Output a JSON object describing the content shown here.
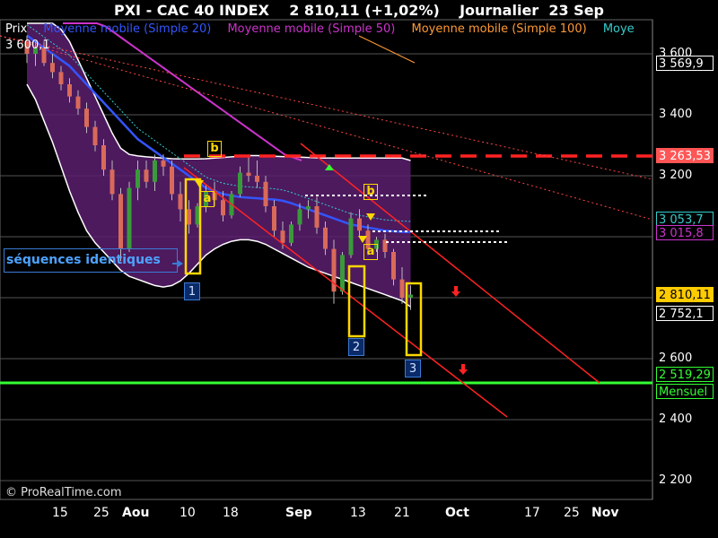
{
  "header": {
    "title": "PXI - CAC 40 INDEX    2 810,11 (+1,02%)    Journalier  23 Sep"
  },
  "legend": [
    {
      "label": "Prix",
      "color": "#ffffff"
    },
    {
      "label": "Moyenne mobile (Simple 20)",
      "color": "#3355ff"
    },
    {
      "label": "Moyenne mobile (Simple 50)",
      "color": "#cc33cc"
    },
    {
      "label": "Moyenne mobile (Simple 100)",
      "color": "#ff9933"
    },
    {
      "label": "Moye",
      "color": "#33cccc"
    }
  ],
  "top_value": "3 600,1",
  "annotations": {
    "sequence_label": "séquences identiques",
    "numbers": [
      "1",
      "2",
      "3"
    ],
    "letters": [
      "a",
      "b",
      "a",
      "b",
      "a"
    ]
  },
  "price_badges": [
    {
      "text": "3 569,9",
      "bg": "#000000",
      "fg": "#ffffff",
      "border": "#ffffff",
      "value": 3569.9
    },
    {
      "text": "3 263,53",
      "bg": "#ff5555",
      "fg": "#ffffff",
      "border": "#ff5555",
      "value": 3263.53
    },
    {
      "text": "3 053,7",
      "bg": "#000000",
      "fg": "#33cccc",
      "border": "#33cccc",
      "value": 3053.7
    },
    {
      "text": "3 015,8",
      "bg": "#000000",
      "fg": "#cc33cc",
      "border": "#cc33cc",
      "value": 3015.8
    },
    {
      "text": "2 810,11",
      "bg": "#ffcc00",
      "fg": "#000000",
      "border": "#ffcc00",
      "value": 2810.11
    },
    {
      "text": "2 752,1",
      "bg": "#000000",
      "fg": "#ffffff",
      "border": "#ffffff",
      "value": 2752.1
    },
    {
      "text": "2 519,29",
      "bg": "#000000",
      "fg": "#33ff33",
      "border": "#33ff33",
      "value": 2519.29
    },
    {
      "text": "Mensuel",
      "bg": "#000000",
      "fg": "#33ff33",
      "border": "#33ff33",
      "value": null
    }
  ],
  "copyright": "© ProRealTime.com",
  "colors": {
    "background": "#000000",
    "grid": "#555555",
    "bollinger_fill": "#5a1e6e",
    "support": "#33ff33",
    "resistance": "#ff2222",
    "annotation": "#ffd700"
  },
  "chart_data": {
    "type": "candlestick",
    "title": "PXI - CAC 40 INDEX    2 810,11 (+1,02%)    Journalier  23 Sep",
    "ylim": [
      2100,
      3700
    ],
    "y_ticks": [
      "2 200",
      "2 400",
      "2 600",
      "3 200",
      "3 400",
      "3 600"
    ],
    "x_ticks": [
      {
        "label": "15",
        "bold": false
      },
      {
        "label": "25",
        "bold": false
      },
      {
        "label": "Aou",
        "bold": true
      },
      {
        "label": "10",
        "bold": false
      },
      {
        "label": "18",
        "bold": false
      },
      {
        "label": "Sep",
        "bold": true
      },
      {
        "label": "13",
        "bold": false
      },
      {
        "label": "21",
        "bold": false
      },
      {
        "label": "Oct",
        "bold": true
      },
      {
        "label": "17",
        "bold": false
      },
      {
        "label": "25",
        "bold": false
      },
      {
        "label": "Nov",
        "bold": true
      }
    ],
    "candles": [
      [
        3640,
        3660,
        3570,
        3600
      ],
      [
        3600,
        3640,
        3560,
        3620
      ],
      [
        3620,
        3640,
        3560,
        3570
      ],
      [
        3570,
        3600,
        3520,
        3540
      ],
      [
        3540,
        3560,
        3480,
        3500
      ],
      [
        3500,
        3520,
        3440,
        3460
      ],
      [
        3460,
        3480,
        3400,
        3420
      ],
      [
        3420,
        3440,
        3340,
        3360
      ],
      [
        3360,
        3380,
        3280,
        3300
      ],
      [
        3300,
        3320,
        3200,
        3220
      ],
      [
        3220,
        3250,
        3120,
        3140
      ],
      [
        3140,
        3160,
        2920,
        2960
      ],
      [
        2960,
        3180,
        2950,
        3160
      ],
      [
        3160,
        3250,
        3120,
        3220
      ],
      [
        3220,
        3250,
        3160,
        3180
      ],
      [
        3180,
        3270,
        3150,
        3250
      ],
      [
        3250,
        3270,
        3200,
        3230
      ],
      [
        3230,
        3250,
        3120,
        3140
      ],
      [
        3140,
        3180,
        3050,
        3090
      ],
      [
        3090,
        3120,
        3010,
        3040
      ],
      [
        3040,
        3110,
        3030,
        3100
      ],
      [
        3100,
        3170,
        3080,
        3150
      ],
      [
        3150,
        3180,
        3100,
        3120
      ],
      [
        3120,
        3150,
        3050,
        3070
      ],
      [
        3070,
        3150,
        3060,
        3140
      ],
      [
        3140,
        3230,
        3130,
        3210
      ],
      [
        3210,
        3270,
        3180,
        3200
      ],
      [
        3200,
        3250,
        3160,
        3180
      ],
      [
        3180,
        3200,
        3080,
        3100
      ],
      [
        3100,
        3120,
        3000,
        3020
      ],
      [
        3020,
        3050,
        2960,
        2980
      ],
      [
        2980,
        3050,
        2970,
        3040
      ],
      [
        3040,
        3110,
        3020,
        3090
      ],
      [
        3090,
        3120,
        3060,
        3100
      ],
      [
        3100,
        3130,
        3010,
        3030
      ],
      [
        3030,
        3050,
        2940,
        2960
      ],
      [
        2960,
        2990,
        2780,
        2820
      ],
      [
        2820,
        2950,
        2810,
        2940
      ],
      [
        2940,
        3080,
        2930,
        3060
      ],
      [
        3060,
        3090,
        3000,
        3020
      ],
      [
        3020,
        3040,
        2940,
        2960
      ],
      [
        2960,
        3000,
        2950,
        2990
      ],
      [
        2990,
        3010,
        2930,
        2950
      ],
      [
        2950,
        2960,
        2840,
        2860
      ],
      [
        2860,
        2900,
        2780,
        2800
      ],
      [
        2800,
        2840,
        2760,
        2810
      ]
    ],
    "bollinger_upper": [
      3700,
      3700,
      3700,
      3700,
      3680,
      3640,
      3580,
      3520,
      3460,
      3400,
      3340,
      3290,
      3270,
      3265,
      3262,
      3260,
      3258,
      3256,
      3255,
      3255,
      3255,
      3256,
      3258,
      3260,
      3262,
      3264,
      3266,
      3266,
      3265,
      3264,
      3263,
      3262,
      3261,
      3260,
      3259,
      3258,
      3258,
      3258,
      3258,
      3258,
      3258,
      3258,
      3258,
      3258,
      3258,
      3250
    ],
    "bollinger_lower": [
      3500,
      3450,
      3380,
      3310,
      3230,
      3150,
      3080,
      3020,
      2980,
      2950,
      2920,
      2890,
      2870,
      2860,
      2850,
      2840,
      2835,
      2840,
      2855,
      2880,
      2910,
      2940,
      2960,
      2975,
      2985,
      2990,
      2990,
      2985,
      2975,
      2960,
      2945,
      2930,
      2915,
      2900,
      2890,
      2880,
      2870,
      2860,
      2850,
      2840,
      2830,
      2820,
      2810,
      2800,
      2790,
      2770
    ],
    "ma20": [
      3660,
      3640,
      3620,
      3600,
      3580,
      3560,
      3530,
      3500,
      3470,
      3440,
      3410,
      3380,
      3350,
      3320,
      3300,
      3280,
      3260,
      3240,
      3220,
      3200,
      3180,
      3160,
      3150,
      3140,
      3135,
      3130,
      3128,
      3126,
      3124,
      3122,
      3118,
      3110,
      3100,
      3090,
      3080,
      3070,
      3060,
      3050,
      3040,
      3035,
      3030,
      3025,
      3020,
      3018,
      3016,
      3015
    ],
    "ma50": [
      3700,
      3700,
      3700,
      3700,
      3700,
      3690,
      3670,
      3650,
      3630,
      3610,
      3590,
      3570,
      3550,
      3530,
      3510,
      3490,
      3470,
      3450,
      3430,
      3410,
      3390,
      3370,
      3350,
      3330,
      3310,
      3290,
      3270,
      3260,
      3250
    ],
    "ma100_label": "Moyenne mobile (Simple 100)"
  }
}
